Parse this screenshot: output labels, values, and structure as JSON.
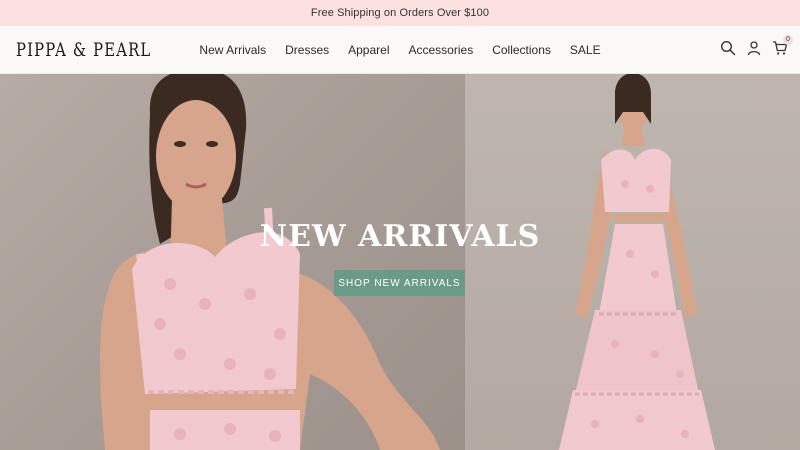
{
  "announcement": "Free Shipping on Orders Over $100",
  "brand": {
    "logo_text": "PIPPA & PEARL"
  },
  "nav": {
    "items": [
      {
        "label": "New Arrivals"
      },
      {
        "label": "Dresses"
      },
      {
        "label": "Apparel"
      },
      {
        "label": "Accessories"
      },
      {
        "label": "Collections"
      },
      {
        "label": "SALE"
      }
    ]
  },
  "header_icons": {
    "search": "search-icon",
    "account": "account-icon",
    "cart": "cart-icon",
    "cart_count": "0"
  },
  "hero": {
    "title": "NEW ARRIVALS",
    "cta": "SHOP NEW ARRIVALS",
    "colors": {
      "cta_bg": "#6b9a87",
      "announcement_bg": "#fbe1e1",
      "outfit": "#f1c9cf"
    }
  }
}
